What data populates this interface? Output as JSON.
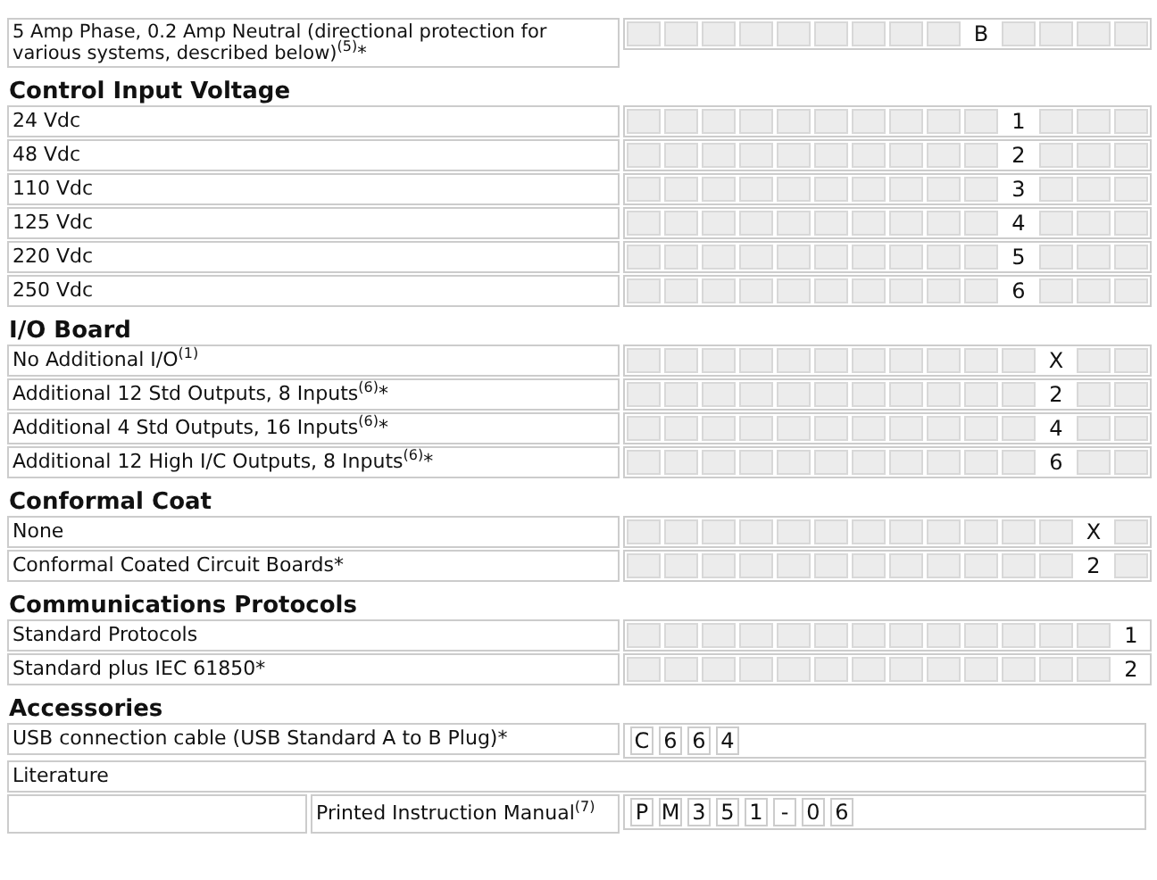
{
  "sections": [
    {
      "rows": [
        {
          "label": "5 Amp Phase, 0.2 Amp Neutral (directional protection for various systems, described below)$^{(5)}$*",
          "cells": [
            {
              "kind": "blank"
            },
            {
              "kind": "blank"
            },
            {
              "kind": "blank"
            },
            {
              "kind": "blank"
            },
            {
              "kind": "blank"
            },
            {
              "kind": "blank"
            },
            {
              "kind": "blank"
            },
            {
              "kind": "blank"
            },
            {
              "kind": "blank"
            },
            {
              "kind": "code",
              "text": "B"
            },
            {
              "kind": "blank"
            },
            {
              "kind": "blank"
            },
            {
              "kind": "blank"
            },
            {
              "kind": "blank"
            }
          ]
        }
      ]
    },
    {
      "title": "Control Input Voltage",
      "rows": [
        {
          "label": "24 Vdc",
          "cells": [
            {
              "kind": "blank"
            },
            {
              "kind": "blank"
            },
            {
              "kind": "blank"
            },
            {
              "kind": "blank"
            },
            {
              "kind": "blank"
            },
            {
              "kind": "blank"
            },
            {
              "kind": "blank"
            },
            {
              "kind": "blank"
            },
            {
              "kind": "blank"
            },
            {
              "kind": "blank"
            },
            {
              "kind": "code",
              "text": "1"
            },
            {
              "kind": "blank"
            },
            {
              "kind": "blank"
            },
            {
              "kind": "blank"
            }
          ]
        },
        {
          "label": "48 Vdc",
          "cells": [
            {
              "kind": "blank"
            },
            {
              "kind": "blank"
            },
            {
              "kind": "blank"
            },
            {
              "kind": "blank"
            },
            {
              "kind": "blank"
            },
            {
              "kind": "blank"
            },
            {
              "kind": "blank"
            },
            {
              "kind": "blank"
            },
            {
              "kind": "blank"
            },
            {
              "kind": "blank"
            },
            {
              "kind": "code",
              "text": "2"
            },
            {
              "kind": "blank"
            },
            {
              "kind": "blank"
            },
            {
              "kind": "blank"
            }
          ]
        },
        {
          "label": "110 Vdc",
          "cells": [
            {
              "kind": "blank"
            },
            {
              "kind": "blank"
            },
            {
              "kind": "blank"
            },
            {
              "kind": "blank"
            },
            {
              "kind": "blank"
            },
            {
              "kind": "blank"
            },
            {
              "kind": "blank"
            },
            {
              "kind": "blank"
            },
            {
              "kind": "blank"
            },
            {
              "kind": "blank"
            },
            {
              "kind": "code",
              "text": "3"
            },
            {
              "kind": "blank"
            },
            {
              "kind": "blank"
            },
            {
              "kind": "blank"
            }
          ]
        },
        {
          "label": "125 Vdc",
          "cells": [
            {
              "kind": "blank"
            },
            {
              "kind": "blank"
            },
            {
              "kind": "blank"
            },
            {
              "kind": "blank"
            },
            {
              "kind": "blank"
            },
            {
              "kind": "blank"
            },
            {
              "kind": "blank"
            },
            {
              "kind": "blank"
            },
            {
              "kind": "blank"
            },
            {
              "kind": "blank"
            },
            {
              "kind": "code",
              "text": "4"
            },
            {
              "kind": "blank"
            },
            {
              "kind": "blank"
            },
            {
              "kind": "blank"
            }
          ]
        },
        {
          "label": "220 Vdc",
          "cells": [
            {
              "kind": "blank"
            },
            {
              "kind": "blank"
            },
            {
              "kind": "blank"
            },
            {
              "kind": "blank"
            },
            {
              "kind": "blank"
            },
            {
              "kind": "blank"
            },
            {
              "kind": "blank"
            },
            {
              "kind": "blank"
            },
            {
              "kind": "blank"
            },
            {
              "kind": "blank"
            },
            {
              "kind": "code",
              "text": "5"
            },
            {
              "kind": "blank"
            },
            {
              "kind": "blank"
            },
            {
              "kind": "blank"
            }
          ]
        },
        {
          "label": "250 Vdc",
          "cells": [
            {
              "kind": "blank"
            },
            {
              "kind": "blank"
            },
            {
              "kind": "blank"
            },
            {
              "kind": "blank"
            },
            {
              "kind": "blank"
            },
            {
              "kind": "blank"
            },
            {
              "kind": "blank"
            },
            {
              "kind": "blank"
            },
            {
              "kind": "blank"
            },
            {
              "kind": "blank"
            },
            {
              "kind": "code",
              "text": "6"
            },
            {
              "kind": "blank"
            },
            {
              "kind": "blank"
            },
            {
              "kind": "blank"
            }
          ]
        }
      ]
    },
    {
      "title": "I/O Board",
      "rows": [
        {
          "label": "No Additional I/O$^{(1)}$",
          "cells": [
            {
              "kind": "blank"
            },
            {
              "kind": "blank"
            },
            {
              "kind": "blank"
            },
            {
              "kind": "blank"
            },
            {
              "kind": "blank"
            },
            {
              "kind": "blank"
            },
            {
              "kind": "blank"
            },
            {
              "kind": "blank"
            },
            {
              "kind": "blank"
            },
            {
              "kind": "blank"
            },
            {
              "kind": "blank"
            },
            {
              "kind": "code",
              "text": "X"
            },
            {
              "kind": "blank"
            },
            {
              "kind": "blank"
            }
          ]
        },
        {
          "label": "Additional 12 Std Outputs, 8 Inputs$^{(6)}$*",
          "cells": [
            {
              "kind": "blank"
            },
            {
              "kind": "blank"
            },
            {
              "kind": "blank"
            },
            {
              "kind": "blank"
            },
            {
              "kind": "blank"
            },
            {
              "kind": "blank"
            },
            {
              "kind": "blank"
            },
            {
              "kind": "blank"
            },
            {
              "kind": "blank"
            },
            {
              "kind": "blank"
            },
            {
              "kind": "blank"
            },
            {
              "kind": "code",
              "text": "2"
            },
            {
              "kind": "blank"
            },
            {
              "kind": "blank"
            }
          ]
        },
        {
          "label": "Additional 4 Std Outputs, 16 Inputs$^{(6)}$*",
          "cells": [
            {
              "kind": "blank"
            },
            {
              "kind": "blank"
            },
            {
              "kind": "blank"
            },
            {
              "kind": "blank"
            },
            {
              "kind": "blank"
            },
            {
              "kind": "blank"
            },
            {
              "kind": "blank"
            },
            {
              "kind": "blank"
            },
            {
              "kind": "blank"
            },
            {
              "kind": "blank"
            },
            {
              "kind": "blank"
            },
            {
              "kind": "code",
              "text": "4"
            },
            {
              "kind": "blank"
            },
            {
              "kind": "blank"
            }
          ]
        },
        {
          "label": "Additional 12 High I/C Outputs, 8 Inputs$^{(6)}$*",
          "cells": [
            {
              "kind": "blank"
            },
            {
              "kind": "blank"
            },
            {
              "kind": "blank"
            },
            {
              "kind": "blank"
            },
            {
              "kind": "blank"
            },
            {
              "kind": "blank"
            },
            {
              "kind": "blank"
            },
            {
              "kind": "blank"
            },
            {
              "kind": "blank"
            },
            {
              "kind": "blank"
            },
            {
              "kind": "blank"
            },
            {
              "kind": "code",
              "text": "6"
            },
            {
              "kind": "blank"
            },
            {
              "kind": "blank"
            }
          ]
        }
      ]
    },
    {
      "title": "Conformal Coat",
      "rows": [
        {
          "label": "None",
          "cells": [
            {
              "kind": "blank"
            },
            {
              "kind": "blank"
            },
            {
              "kind": "blank"
            },
            {
              "kind": "blank"
            },
            {
              "kind": "blank"
            },
            {
              "kind": "blank"
            },
            {
              "kind": "blank"
            },
            {
              "kind": "blank"
            },
            {
              "kind": "blank"
            },
            {
              "kind": "blank"
            },
            {
              "kind": "blank"
            },
            {
              "kind": "blank"
            },
            {
              "kind": "code",
              "text": "X"
            },
            {
              "kind": "blank"
            }
          ]
        },
        {
          "label": "Conformal Coated Circuit Boards*",
          "cells": [
            {
              "kind": "blank"
            },
            {
              "kind": "blank"
            },
            {
              "kind": "blank"
            },
            {
              "kind": "blank"
            },
            {
              "kind": "blank"
            },
            {
              "kind": "blank"
            },
            {
              "kind": "blank"
            },
            {
              "kind": "blank"
            },
            {
              "kind": "blank"
            },
            {
              "kind": "blank"
            },
            {
              "kind": "blank"
            },
            {
              "kind": "blank"
            },
            {
              "kind": "code",
              "text": "2"
            },
            {
              "kind": "blank"
            }
          ]
        }
      ]
    },
    {
      "title": "Communications Protocols",
      "rows": [
        {
          "label": "Standard Protocols",
          "cells": [
            {
              "kind": "blank"
            },
            {
              "kind": "blank"
            },
            {
              "kind": "blank"
            },
            {
              "kind": "blank"
            },
            {
              "kind": "blank"
            },
            {
              "kind": "blank"
            },
            {
              "kind": "blank"
            },
            {
              "kind": "blank"
            },
            {
              "kind": "blank"
            },
            {
              "kind": "blank"
            },
            {
              "kind": "blank"
            },
            {
              "kind": "blank"
            },
            {
              "kind": "blank"
            },
            {
              "kind": "code",
              "text": "1"
            }
          ]
        },
        {
          "label": "Standard plus IEC 61850*",
          "cells": [
            {
              "kind": "blank"
            },
            {
              "kind": "blank"
            },
            {
              "kind": "blank"
            },
            {
              "kind": "blank"
            },
            {
              "kind": "blank"
            },
            {
              "kind": "blank"
            },
            {
              "kind": "blank"
            },
            {
              "kind": "blank"
            },
            {
              "kind": "blank"
            },
            {
              "kind": "blank"
            },
            {
              "kind": "blank"
            },
            {
              "kind": "blank"
            },
            {
              "kind": "blank"
            },
            {
              "kind": "code",
              "text": "2"
            }
          ]
        }
      ]
    }
  ],
  "accessories": {
    "title": "Accessories",
    "rows": [
      {
        "kind": "item",
        "label": "USB connection cable (USB Standard A to B Plug)*",
        "code": [
          "C",
          "6",
          "6",
          "4"
        ]
      },
      {
        "kind": "heading",
        "label": "Literature"
      },
      {
        "kind": "subitem",
        "label": "Printed Instruction Manual$^{(7)}$",
        "code": [
          "P",
          "M",
          "3",
          "5",
          "1",
          "-",
          "0",
          "6"
        ]
      }
    ]
  }
}
